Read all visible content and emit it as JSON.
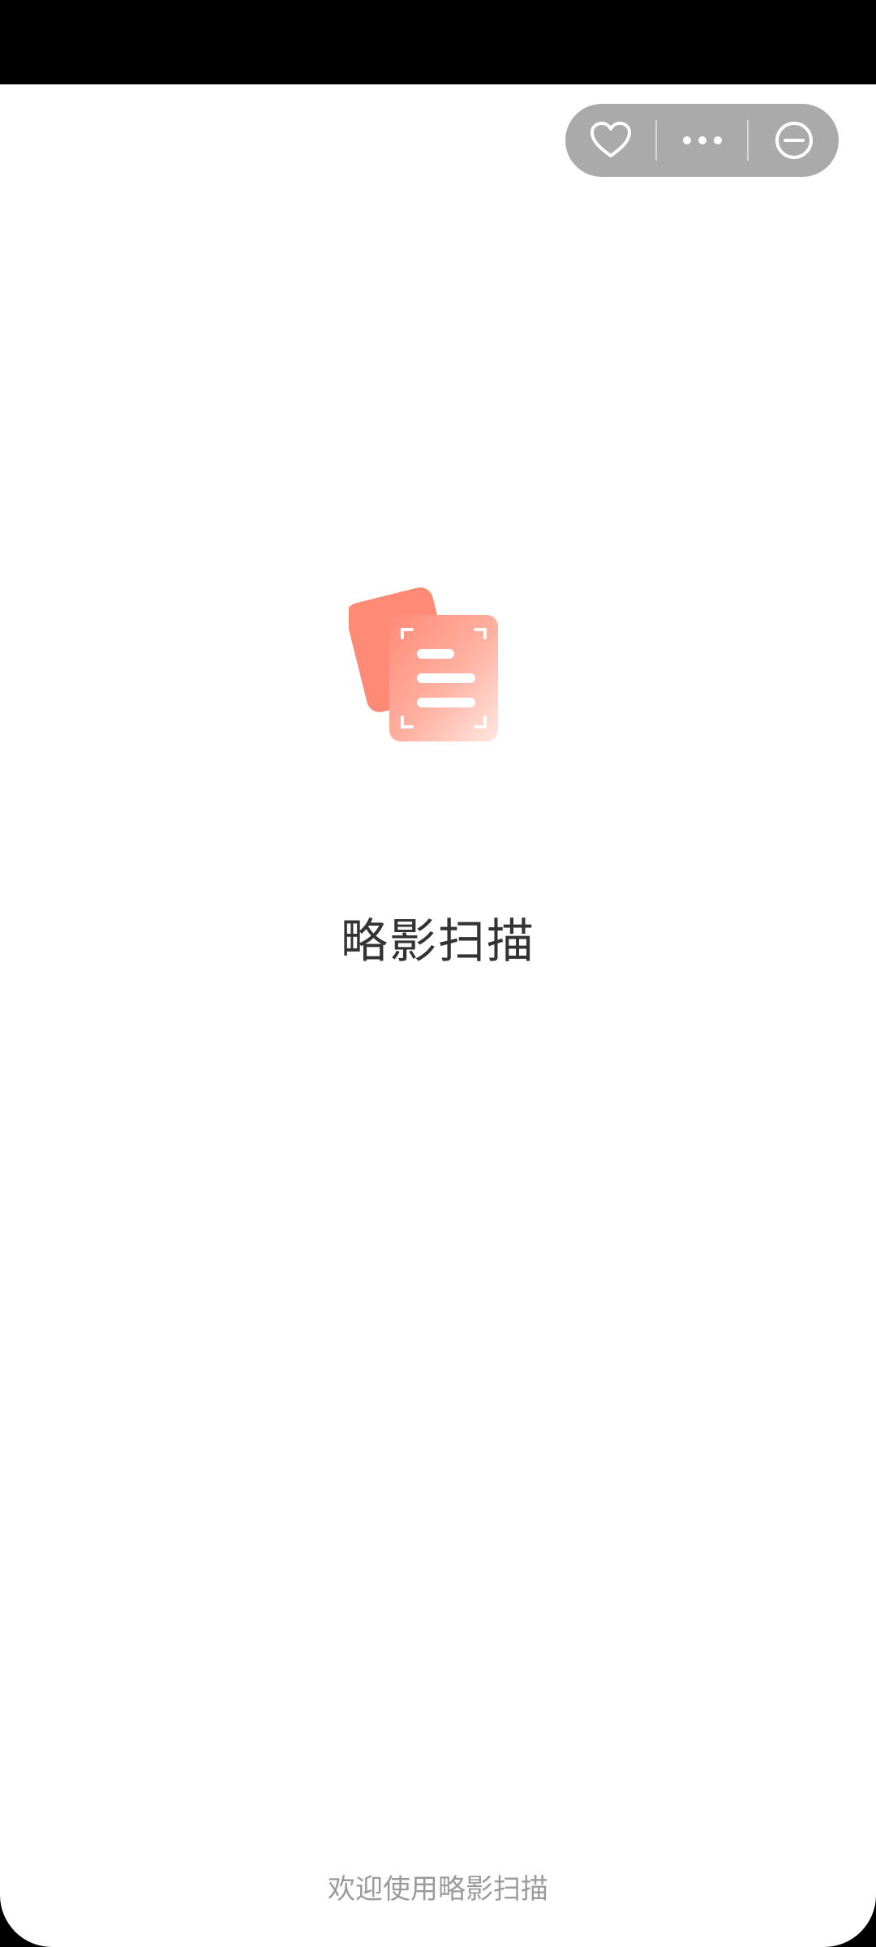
{
  "app": {
    "name": "略影扫描",
    "welcome_text": "欢迎使用略影扫描"
  },
  "capsule": {
    "icons": [
      "heart-icon",
      "more-dots-icon",
      "minus-circle-icon"
    ],
    "background": "#aaaaaa"
  },
  "colors": {
    "logo_primary": "#ff8a75",
    "logo_light": "#ffd3c9",
    "title": "#333333",
    "subtitle": "#9a9a9a"
  }
}
